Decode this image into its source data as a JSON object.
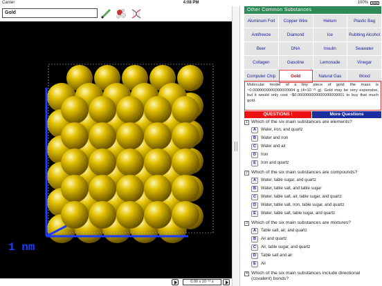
{
  "status": {
    "carrier": "Carrier",
    "time": "4:08 PM",
    "battery": "100%"
  },
  "molecule_name": "Gold",
  "icons": [
    "pencil-icon",
    "atom-icon",
    "dna-icon"
  ],
  "scale_label": "1 nm",
  "time_readout": "0.00 x 10⁻¹² s",
  "atom_color": "#d4b400",
  "axis_color": "#1a3cff",
  "substances": {
    "header": "Other Common Substances",
    "items": [
      "Aluminum Foil",
      "Copper Wire",
      "Helium",
      "Plastic Bag",
      "Antifreeze",
      "Diamond",
      "Ice",
      "Rubbing Alcohol",
      "Beer",
      "DNA",
      "Insulin",
      "Seawater",
      "Collagen",
      "Gasoline",
      "Lemonade",
      "Vinegar",
      "Computer Chip",
      "Gold",
      "Natural Gas",
      "Wood"
    ],
    "selected": "Gold"
  },
  "description": "Molecular model of a tiny piece of gold; the mass is ~0.0000000000000000004 g (4×10⁻²¹ g). Gold may be very expensive, but it would only cost ~$0.000000000000000000001 to buy that much gold.",
  "questions_button": "QUESTIONS !",
  "more_questions_button": "More Questions",
  "questions": [
    {
      "num": "1",
      "text": "Which of the six main substances are elements?",
      "answers": [
        {
          "letter": "A",
          "text": "Water, iron, and quartz"
        },
        {
          "letter": "B",
          "text": "Water and iron"
        },
        {
          "letter": "C",
          "text": "Water and air"
        },
        {
          "letter": "D",
          "text": "Iron"
        },
        {
          "letter": "E",
          "text": "Iron and quartz"
        }
      ]
    },
    {
      "num": "2",
      "text": "Which of the six main substances are compounds?",
      "answers": [
        {
          "letter": "A",
          "text": "Water, table sugar, and quartz"
        },
        {
          "letter": "B",
          "text": "Water, table salt, and table sugar"
        },
        {
          "letter": "C",
          "text": "Water, table salt, air, table sugar, and quartz"
        },
        {
          "letter": "D",
          "text": "Water, table salt, iron, table sugar, and quartz"
        },
        {
          "letter": "E",
          "text": "Water, table salt, table sugar, and quartz"
        }
      ]
    },
    {
      "num": "3",
      "text": "Which of the six main substances are mixtures?",
      "answers": [
        {
          "letter": "A",
          "text": "Table salt, air, and quartz"
        },
        {
          "letter": "B",
          "text": "Air and quartz"
        },
        {
          "letter": "C",
          "text": "Air, table sugar, and quartz"
        },
        {
          "letter": "D",
          "text": "Table salt and air"
        },
        {
          "letter": "E",
          "text": "Air"
        }
      ]
    },
    {
      "num": "4",
      "text": "Which of the six main substances include directional (covalent) bonds?",
      "answers": []
    }
  ]
}
